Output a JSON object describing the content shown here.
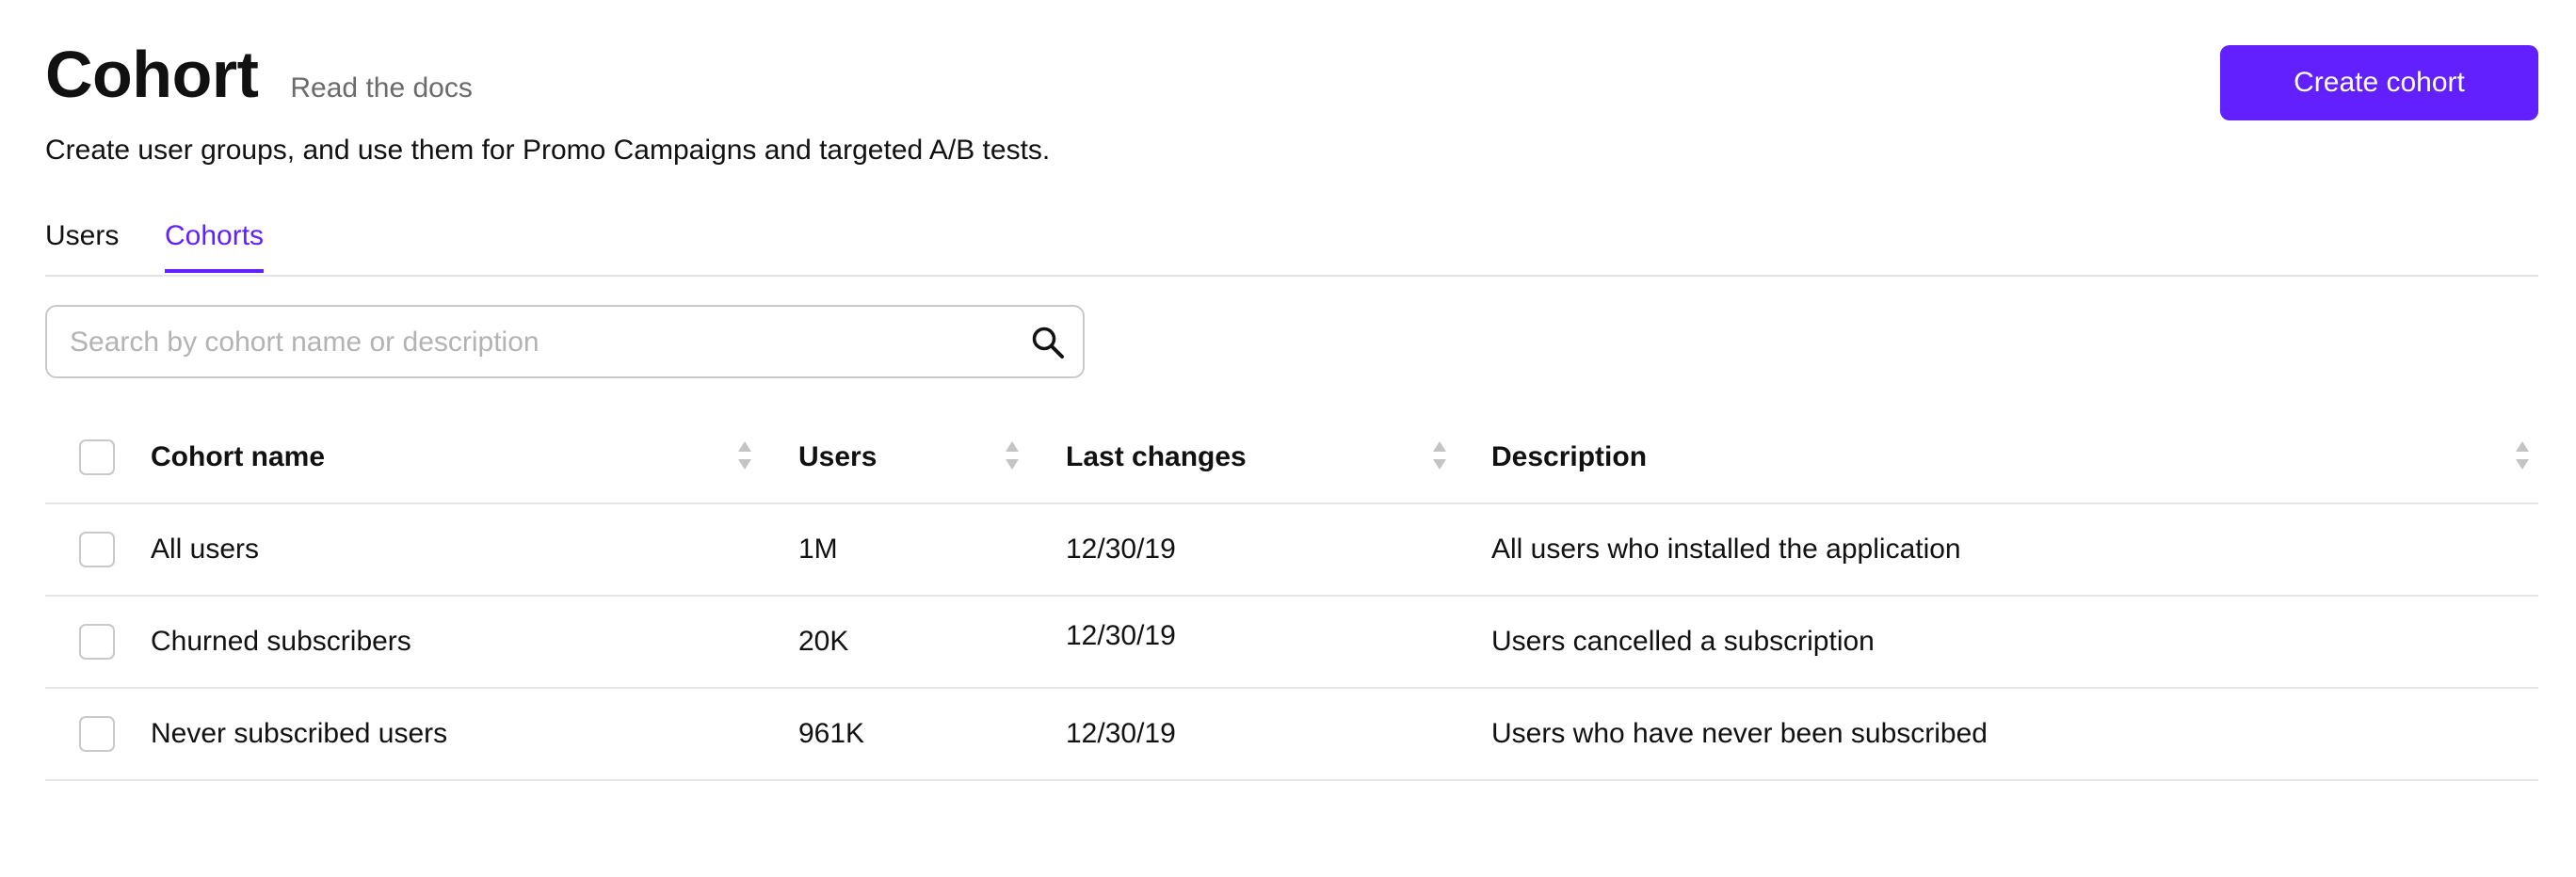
{
  "header": {
    "title": "Cohort",
    "docs_link": "Read the docs",
    "subtitle": "Create user groups, and use them for Promo Campaigns and targeted A/B tests.",
    "create_button": "Create cohort"
  },
  "tabs": [
    {
      "label": "Users",
      "active": false
    },
    {
      "label": "Cohorts",
      "active": true
    }
  ],
  "search": {
    "placeholder": "Search by cohort name or description",
    "value": "",
    "icon": "search-icon"
  },
  "table": {
    "columns": [
      "Cohort name",
      "Users",
      "Last changes",
      "Description"
    ],
    "rows": [
      {
        "name": "All users",
        "users": "1M",
        "last_changes": "12/30/19",
        "description": "All users who installed the application"
      },
      {
        "name": "Churned subscribers",
        "users": "20K",
        "last_changes": "12/30/19",
        "description": "Users cancelled a subscription"
      },
      {
        "name": "Never subscribed users",
        "users": "961K",
        "last_changes": "12/30/19",
        "description": "Users who have never been subscribed"
      }
    ]
  },
  "colors": {
    "accent": "#6220ff",
    "text": "#111111",
    "muted": "#6b6b6b",
    "border": "#e6e6e6"
  }
}
